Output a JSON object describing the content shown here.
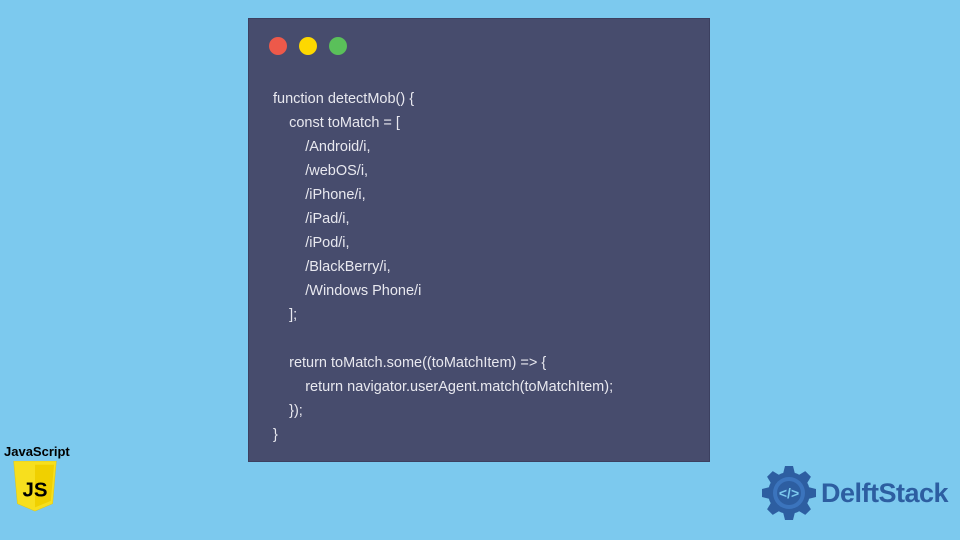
{
  "code_window": {
    "lines": [
      "function detectMob() {",
      "    const toMatch = [",
      "        /Android/i,",
      "        /webOS/i,",
      "        /iPhone/i,",
      "        /iPad/i,",
      "        /iPod/i,",
      "        /BlackBerry/i,",
      "        /Windows Phone/i",
      "    ];",
      "",
      "    return toMatch.some((toMatchItem) => {",
      "        return navigator.userAgent.match(toMatchItem);",
      "    });",
      "}"
    ]
  },
  "js_badge": {
    "label": "JavaScript",
    "shield_text": "JS"
  },
  "delftstack": {
    "text": "DelftStack"
  },
  "colors": {
    "background": "#7cc9ee",
    "window": "#474c6d",
    "code_text": "#e8e8ef",
    "js_yellow": "#f7df1e",
    "delft_blue": "#2d5ea1"
  }
}
